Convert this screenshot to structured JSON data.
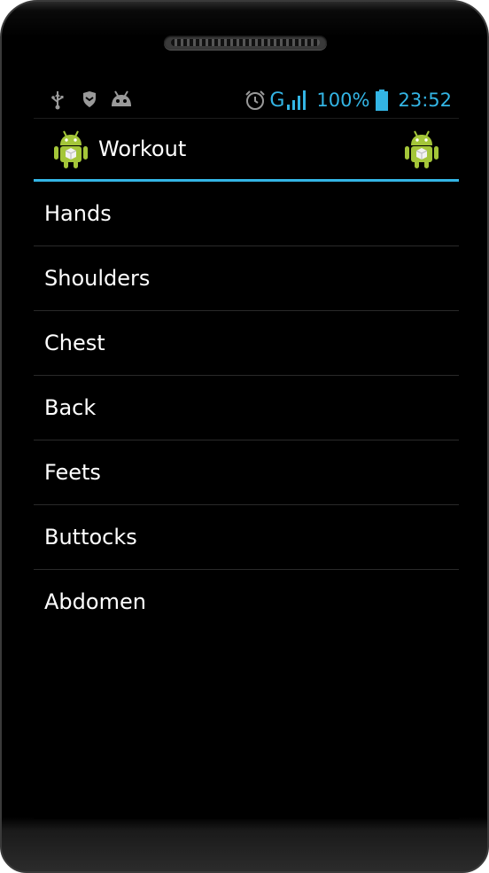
{
  "status_bar": {
    "left_icons": [
      "usb-icon",
      "shield-icon",
      "android-icon"
    ],
    "network": "G",
    "battery": "100%",
    "time": "23:52",
    "accent_color": "#33b5e5"
  },
  "action_bar": {
    "title": "Workout",
    "underline_color": "#33b5e5"
  },
  "list": {
    "items": [
      {
        "label": "Hands"
      },
      {
        "label": "Shoulders"
      },
      {
        "label": "Chest"
      },
      {
        "label": "Back"
      },
      {
        "label": "Feets"
      },
      {
        "label": "Buttocks"
      },
      {
        "label": "Abdomen"
      }
    ]
  }
}
